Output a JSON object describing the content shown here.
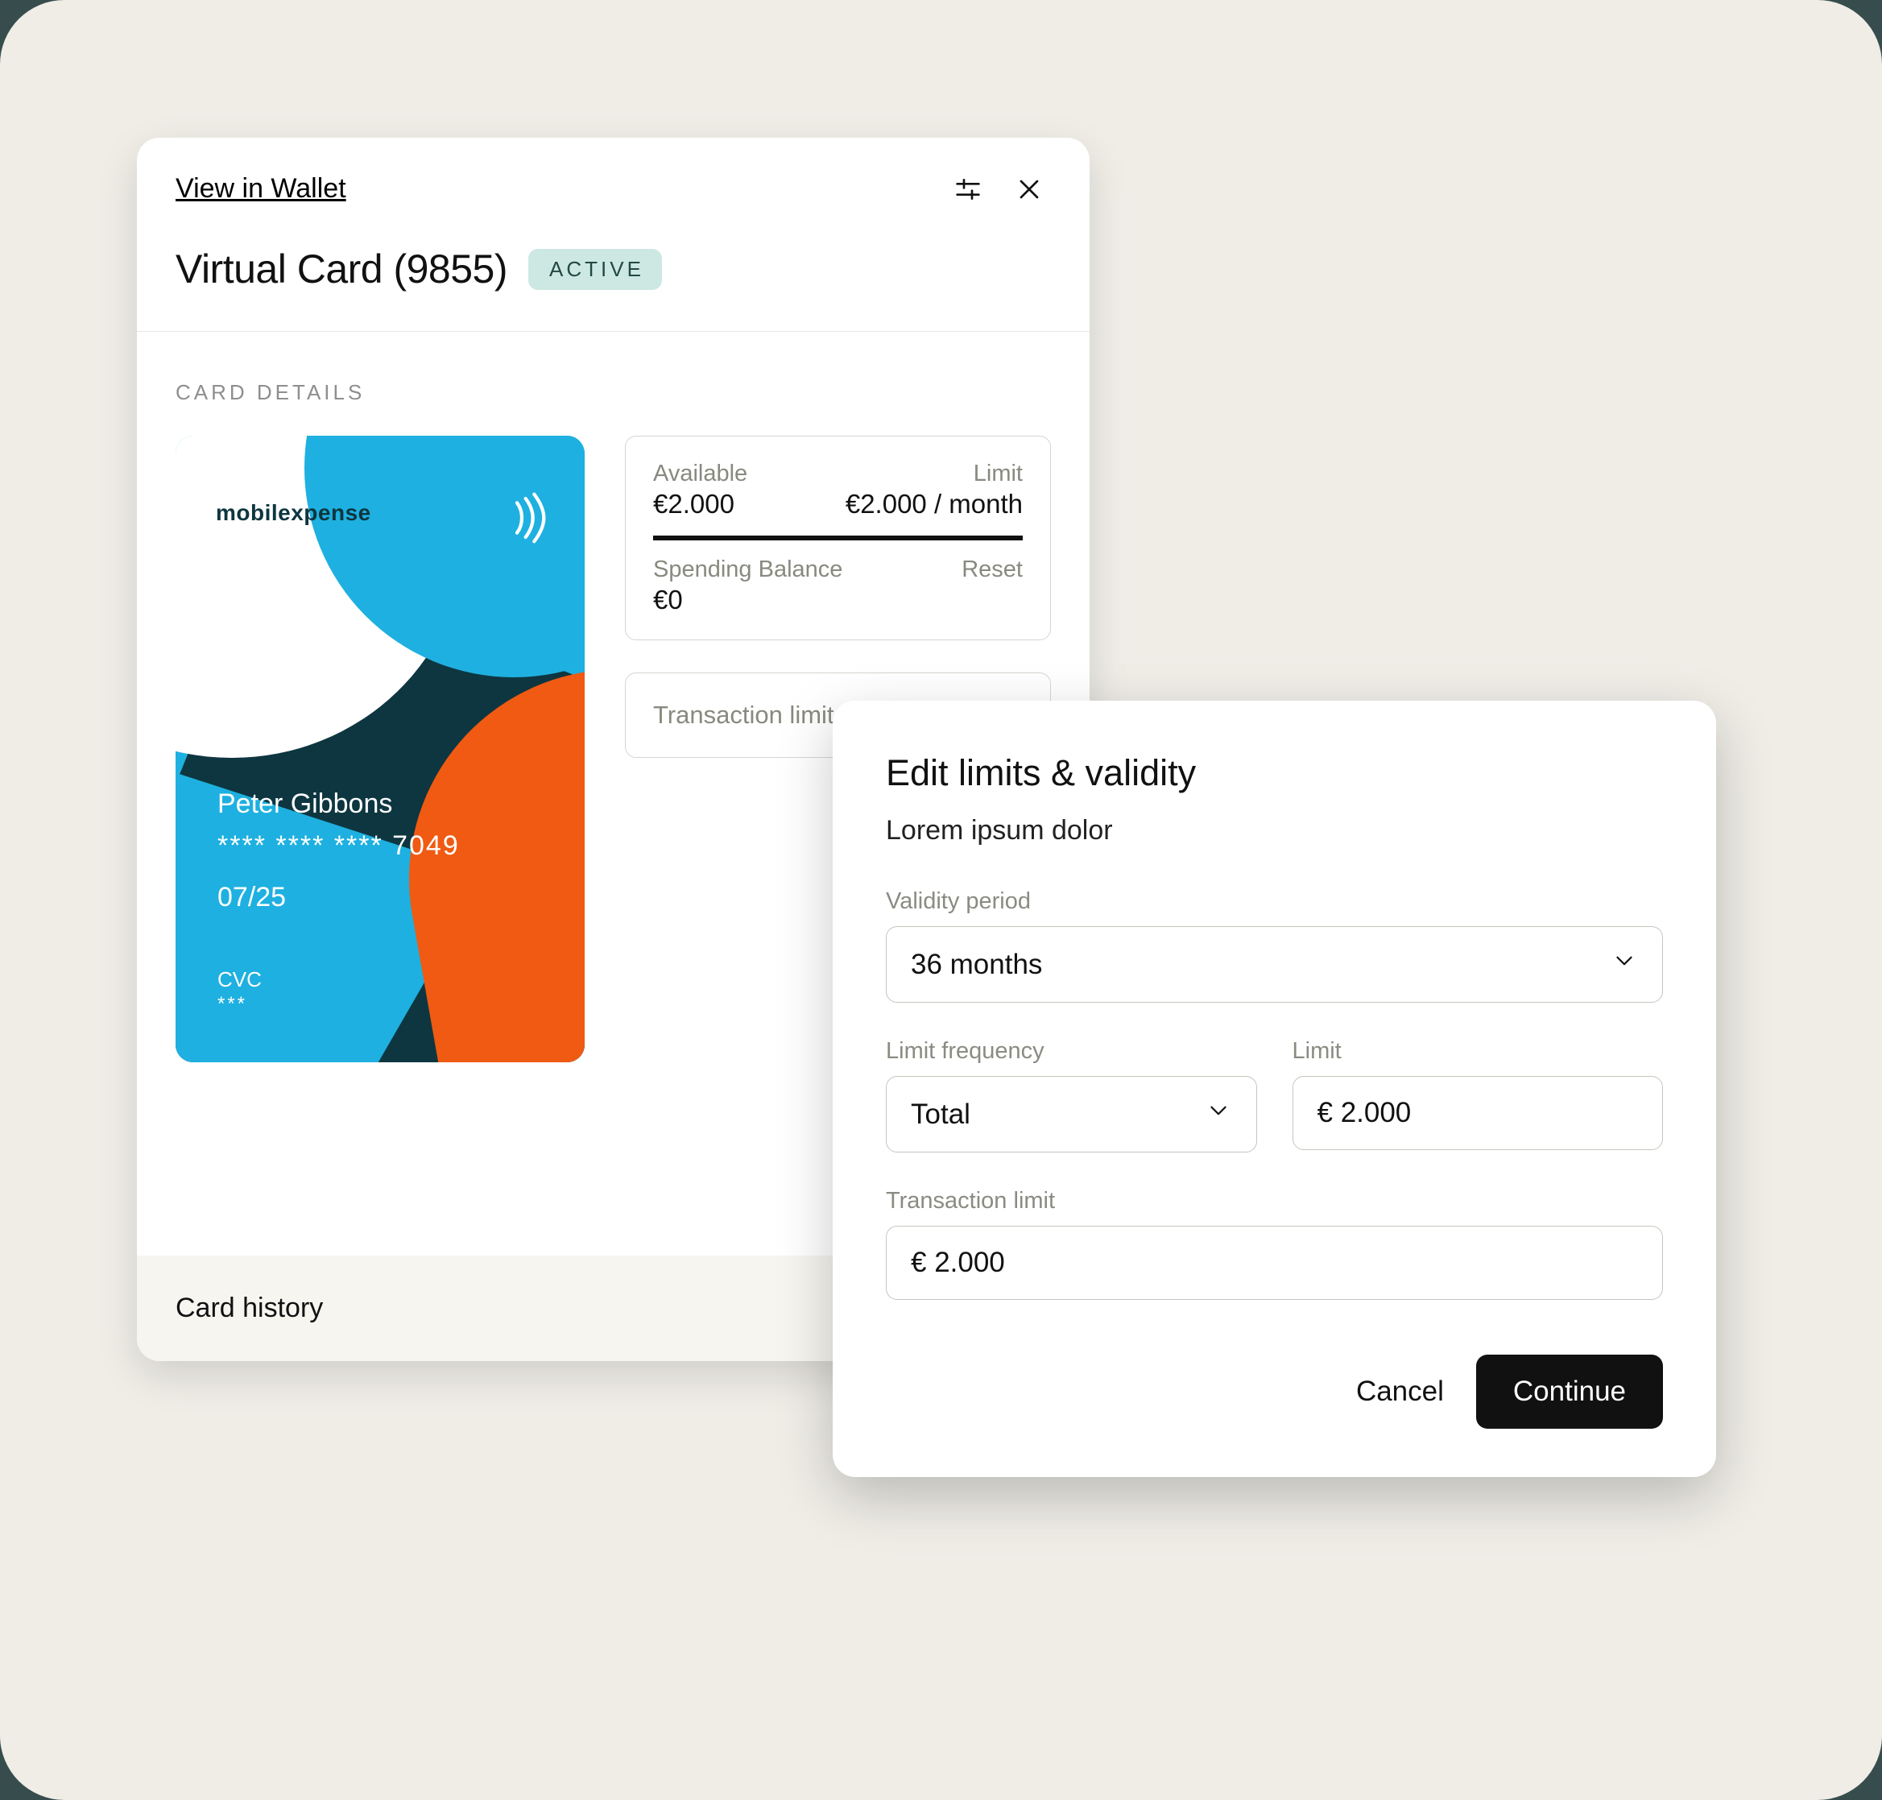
{
  "header": {
    "view_in_wallet": "View in Wallet"
  },
  "card": {
    "title": "Virtual Card (9855)",
    "status": "ACTIVE",
    "section_label": "CARD DETAILS",
    "brand": "mobilexpense",
    "holder_name": "Peter Gibbons",
    "masked_number": "**** **** **** 7049",
    "expiry": "07/25",
    "cvc_label": "CVC",
    "cvc_masked": "***"
  },
  "balances": {
    "available_label": "Available",
    "available_value": "€2.000",
    "limit_label": "Limit",
    "limit_value": "€2.000 / month",
    "spending_label": "Spending Balance",
    "spending_value": "€0",
    "reset_label": "Reset",
    "transaction_limit_label": "Transaction limit"
  },
  "footer": {
    "history": "Card history"
  },
  "modal": {
    "title": "Edit limits & validity",
    "subtitle": "Lorem ipsum dolor",
    "validity_label": "Validity period",
    "validity_value": "36 months",
    "frequency_label": "Limit frequency",
    "frequency_value": "Total",
    "limit_label": "Limit",
    "limit_value": "€ 2.000",
    "txn_limit_label": "Transaction limit",
    "txn_limit_value": "€ 2.000",
    "cancel": "Cancel",
    "continue": "Continue"
  }
}
